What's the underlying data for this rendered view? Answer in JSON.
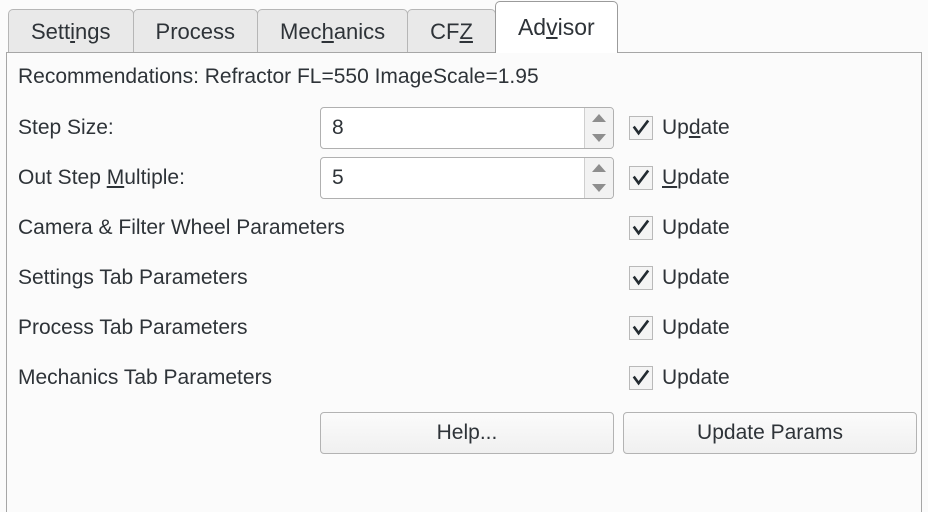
{
  "tabs": [
    {
      "label": "Settings",
      "pre": "Sett",
      "mnemonic": "i",
      "post": "ngs",
      "selected": false,
      "name": "tab-settings"
    },
    {
      "label": "Process",
      "pre": "Process",
      "mnemonic": "",
      "post": "",
      "selected": false,
      "name": "tab-process"
    },
    {
      "label": "Mechanics",
      "pre": "Mec",
      "mnemonic": "h",
      "post": "anics",
      "selected": false,
      "name": "tab-mechanics"
    },
    {
      "label": "CFZ",
      "pre": "CF",
      "mnemonic": "Z",
      "post": "",
      "selected": false,
      "name": "tab-cfz"
    },
    {
      "label": "Advisor",
      "pre": "Ad",
      "mnemonic": "v",
      "post": "isor",
      "selected": true,
      "name": "tab-advisor"
    }
  ],
  "panel": {
    "recommendations": "Recommendations: Refractor FL=550 ImageScale=1.95"
  },
  "rows": [
    {
      "name": "step-size",
      "label_pre": "Step Size:",
      "label_mnemonic": "",
      "label_post": "",
      "has_spin": true,
      "spin_value": "8",
      "check_checked": true,
      "check_pre": "Up",
      "check_mnemonic": "d",
      "check_post": "ate"
    },
    {
      "name": "out-step-multiple",
      "label_pre": "Out Step ",
      "label_mnemonic": "M",
      "label_post": "ultiple:",
      "has_spin": true,
      "spin_value": "5",
      "check_checked": true,
      "check_pre": "",
      "check_mnemonic": "U",
      "check_post": "pdate"
    },
    {
      "name": "camera-filter-wheel-parameters",
      "label_pre": "Camera & Filter Wheel Parameters",
      "label_mnemonic": "",
      "label_post": "",
      "has_spin": false,
      "spin_value": "",
      "check_checked": true,
      "check_pre": "Update",
      "check_mnemonic": "",
      "check_post": ""
    },
    {
      "name": "settings-tab-parameters",
      "label_pre": "Settings Tab Parameters",
      "label_mnemonic": "",
      "label_post": "",
      "has_spin": false,
      "spin_value": "",
      "check_checked": true,
      "check_pre": "Update",
      "check_mnemonic": "",
      "check_post": ""
    },
    {
      "name": "process-tab-parameters",
      "label_pre": "Process Tab Parameters",
      "label_mnemonic": "",
      "label_post": "",
      "has_spin": false,
      "spin_value": "",
      "check_checked": true,
      "check_pre": "Update",
      "check_mnemonic": "",
      "check_post": ""
    },
    {
      "name": "mechanics-tab-parameters",
      "label_pre": "Mechanics Tab Parameters",
      "label_mnemonic": "",
      "label_post": "",
      "has_spin": false,
      "spin_value": "",
      "check_checked": true,
      "check_pre": "Update",
      "check_mnemonic": "",
      "check_post": ""
    }
  ],
  "buttons": {
    "help": "Help...",
    "update_params": "Update Params"
  },
  "colors": {
    "panel_background": "#fbfbfb",
    "tab_background": "#e9e9e9",
    "tab_selected_background": "#ffffff",
    "border": "#a6a6a6",
    "text": "#2e3338",
    "field_background": "#ffffff"
  }
}
